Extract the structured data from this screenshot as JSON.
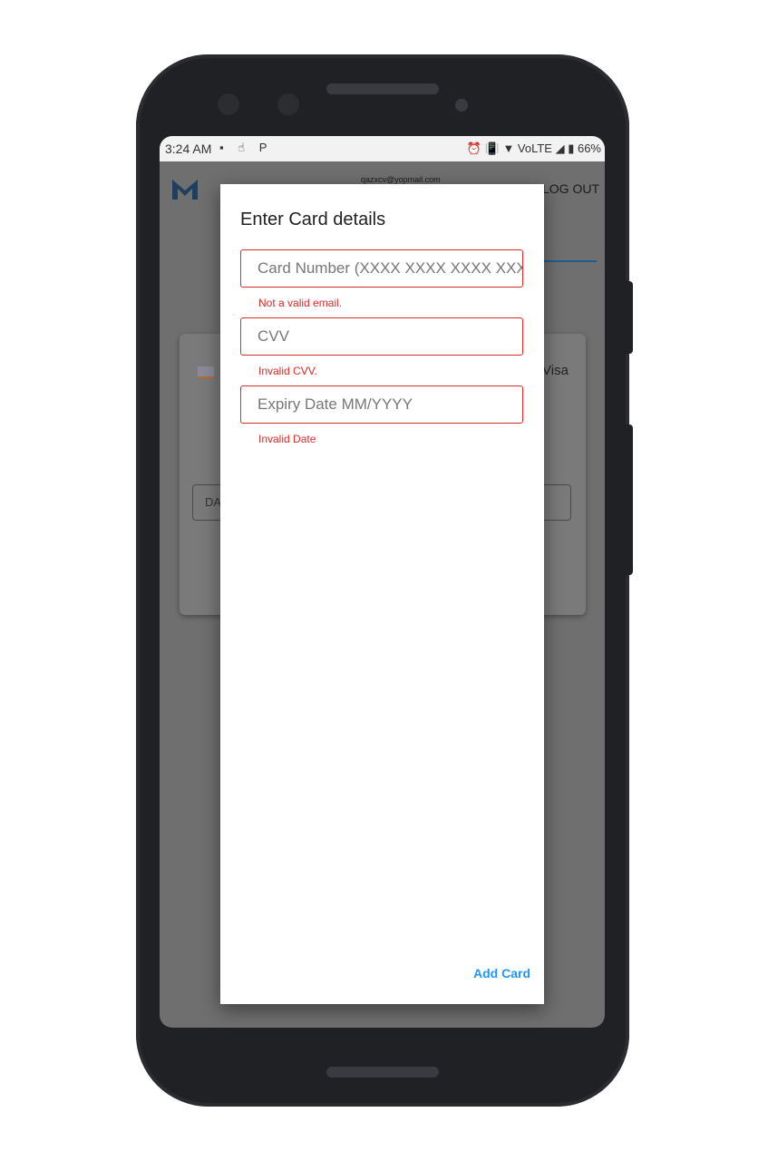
{
  "status_bar": {
    "time": "3:24 AM",
    "left_icons": [
      "image-icon",
      "touch-icon",
      "parking-icon"
    ],
    "left_glyphs": "▪ ☝ P",
    "right_text": "⏰ 📳 ▼ VoLTE ◢ ▮ 66%",
    "battery": "66%"
  },
  "app": {
    "email": "qazxcv@yopmail.com",
    "logout_label": "LOG OUT",
    "card_brand": "Visa",
    "input_fragment": "DA",
    "accent_color": "#1d5f8f"
  },
  "dialog": {
    "title": "Enter Card details",
    "fields": [
      {
        "placeholder": "Card Number (XXXX XXXX XXXX XXXX)",
        "error": "Not a valid email."
      },
      {
        "placeholder": "CVV",
        "error": "Invalid CVV."
      },
      {
        "placeholder": "Expiry Date MM/YYYY",
        "error": "Invalid Date"
      }
    ],
    "add_card_label": "Add Card",
    "error_color": "#d32f2f",
    "action_color": "#2196f3"
  }
}
